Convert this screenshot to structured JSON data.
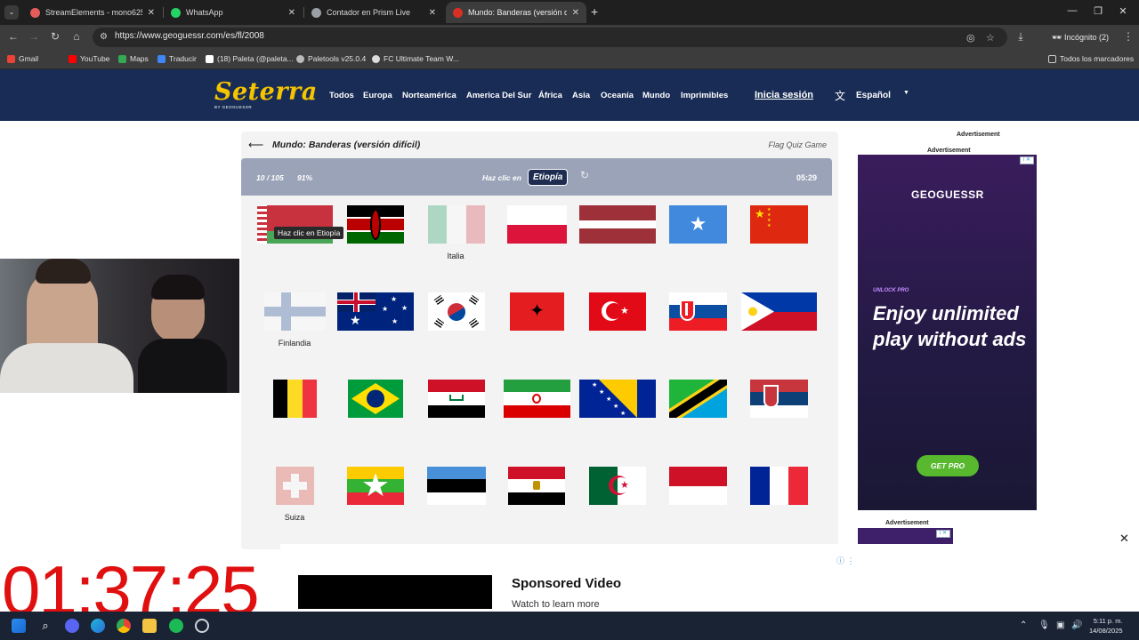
{
  "browser": {
    "tabs": [
      {
        "label": "StreamElements - mono625",
        "color": "#e35b5b"
      },
      {
        "label": "WhatsApp",
        "color": "#25d366"
      },
      {
        "label": "Contador en Prism Live",
        "color": "#9aa0a6"
      },
      {
        "label": "Mundo: Banderas (versión difíc",
        "color": "#d93025"
      }
    ],
    "url": "https://www.geoguessr.com/es/fl/2008",
    "profile": "Incógnito (2)",
    "bookmarks": [
      {
        "label": "Gmail",
        "color": "#ea4335"
      },
      {
        "label": "YouTube",
        "color": "#ff0000"
      },
      {
        "label": "Maps",
        "color": "#34a853"
      },
      {
        "label": "Traducir",
        "color": "#4285f4"
      },
      {
        "label": "(18) Paleta (@paleta...",
        "color": "#ffffff"
      },
      {
        "label": "Paletools v25.0.4",
        "color": "#bbbbbb"
      },
      {
        "label": "FC Ultimate Team W...",
        "color": "#dddddd"
      }
    ],
    "all_bookmarks": "Todos los marcadores"
  },
  "site": {
    "logo": "Seterra",
    "logo_sub": "BY GEOGUESSR",
    "nav": [
      "Todos",
      "Europa",
      "Norteamérica",
      "America Del Sur",
      "África",
      "Asia",
      "Oceanía",
      "Mundo",
      "Imprimibles"
    ],
    "login": "Inicia sesión",
    "language": "Español"
  },
  "quiz": {
    "title": "Mundo: Banderas (versión difícil)",
    "subtitle": "Flag Quiz Game",
    "score": "10 / 105",
    "percent": "91%",
    "prompt": "Haz clic en",
    "target": "Etiopía",
    "timer": "05:29",
    "tooltip": "Haz clic en Etiopía",
    "captions": [
      "Italia",
      "Finlandia",
      "Suiza"
    ]
  },
  "ads": {
    "label": "Advertisement",
    "right_logo": "GEOGUESSR",
    "unlock": "UNLOCK PRO",
    "headline": "Enjoy unlimited play without ads",
    "cta": "GET PRO",
    "sponsored": "Sponsored Video",
    "watch": "Watch to learn more"
  },
  "overlay": {
    "counter": "01:37:25"
  },
  "taskbar": {
    "time": "5:11 p. m.",
    "date": "14/08/2025"
  }
}
